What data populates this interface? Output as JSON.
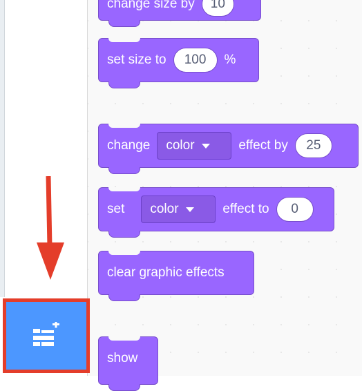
{
  "blocks": {
    "change_size": {
      "label": "change size by",
      "value": "10"
    },
    "set_size": {
      "label": "set size to",
      "value": "100",
      "unit": "%"
    },
    "change_effect": {
      "label": "change",
      "dropdown": "color",
      "label2": "effect by",
      "value": "25"
    },
    "set_effect": {
      "label": "set",
      "dropdown": "color",
      "label2": "effect to",
      "value": "0"
    },
    "clear_effects": {
      "label": "clear graphic effects"
    },
    "show": {
      "label": "show"
    }
  },
  "extension_button": {
    "icon": "add-extension-icon"
  },
  "annotation": {
    "color": "#e43d2a",
    "icon": "arrow-down-icon"
  },
  "colors": {
    "looks_block": "#9966ff",
    "extension_button": "#4c97ff",
    "highlight": "#e43d2a"
  }
}
